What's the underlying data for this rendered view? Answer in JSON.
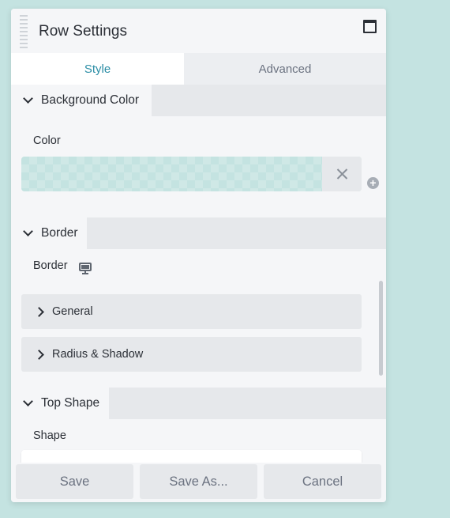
{
  "panel": {
    "title": "Row Settings"
  },
  "tabs": [
    {
      "label": "Style",
      "active": true
    },
    {
      "label": "Advanced",
      "active": false
    }
  ],
  "sections": {
    "background_color": {
      "title": "Background Color",
      "field_label": "Color",
      "color_value": "#c4e3e1"
    },
    "border": {
      "title": "Border",
      "field_label": "Border",
      "items": [
        {
          "label": "General"
        },
        {
          "label": "Radius & Shadow"
        }
      ]
    },
    "top_shape": {
      "title": "Top Shape",
      "field_label": "Shape"
    }
  },
  "footer": {
    "save": "Save",
    "save_as": "Save As...",
    "cancel": "Cancel"
  },
  "colors": {
    "accent": "#2c8ea6",
    "background": "#c4e3e1"
  }
}
